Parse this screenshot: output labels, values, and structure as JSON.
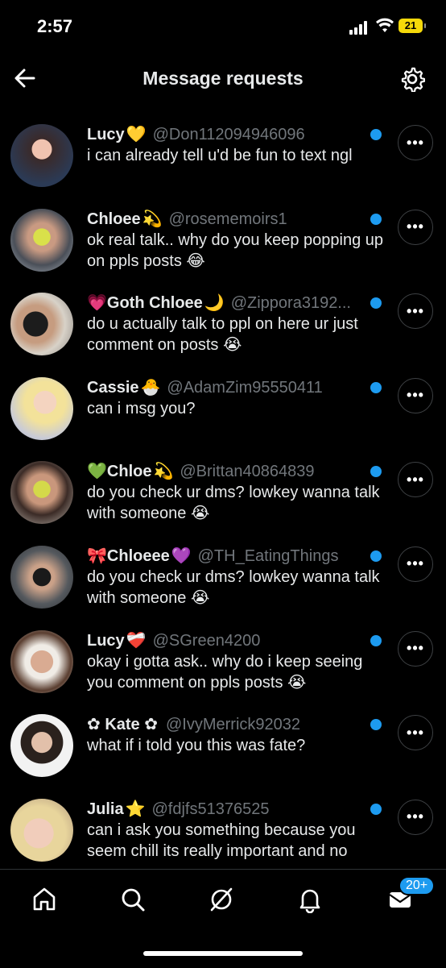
{
  "status": {
    "time": "2:57",
    "battery": "21"
  },
  "header": {
    "title": "Message requests",
    "back_icon": "back-arrow-icon",
    "settings_icon": "gear-icon"
  },
  "requests": [
    {
      "name": "Lucy",
      "emoji": "💛",
      "handle": "@Don112094946096",
      "message": "i can already tell u'd be fun to text ngl",
      "unread": true
    },
    {
      "name": "Chloee",
      "emoji": "💫",
      "handle": "@rosememoirs1",
      "message": "ok real talk.. why do you keep popping up on ppls posts 😂",
      "unread": true
    },
    {
      "name": "💗Goth Chloee",
      "emoji": "🌙",
      "handle": "@Zippora3192...",
      "message": "do u actually talk to ppl on here ur just comment on posts 😭",
      "unread": true
    },
    {
      "name": "Cassie",
      "emoji": "🐣",
      "handle": "@AdamZim95550411",
      "message": "can i msg you?",
      "unread": true
    },
    {
      "name": "💚Chloe",
      "emoji": "💫",
      "handle": "@Brittan40864839",
      "message": "do you check ur dms? lowkey wanna talk with someone 😭",
      "unread": true
    },
    {
      "name": "🎀Chloeee",
      "emoji": "💜",
      "handle": "@TH_EatingThings",
      "message": "do you check ur dms? lowkey wanna talk with someone 😭",
      "unread": true
    },
    {
      "name": "Lucy",
      "emoji": "❤️‍🩹",
      "handle": "@SGreen4200",
      "message": "okay i gotta ask.. why do i keep seeing you comment on ppls posts 😭",
      "unread": true
    },
    {
      "name": "✿ Kate ✿",
      "emoji": "",
      "handle": "@IvyMerrick92032",
      "message": "what if i told you this was fate?",
      "unread": true
    },
    {
      "name": "Julia",
      "emoji": "⭐",
      "handle": "@fdjfs51376525",
      "message": "can i ask you something because you seem chill its really important and no",
      "unread": true
    }
  ],
  "more_label": "•••",
  "nav": {
    "items": [
      "home-icon",
      "search-icon",
      "grok-icon",
      "notifications-icon",
      "messages-icon"
    ],
    "messages_badge": "20+"
  },
  "colors": {
    "background": "#000000",
    "accent": "#1d9bf0",
    "muted": "#71767b"
  }
}
